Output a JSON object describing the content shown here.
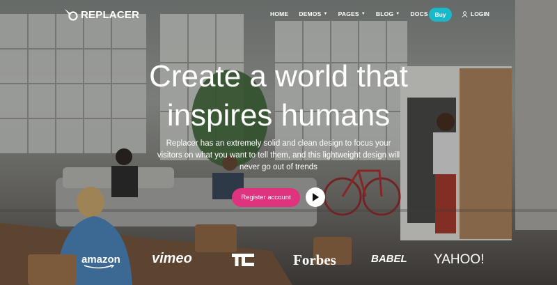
{
  "brand": {
    "name": "REPLACER"
  },
  "nav": {
    "items": [
      {
        "label": "HOME",
        "dropdown": false
      },
      {
        "label": "DEMOS",
        "dropdown": true
      },
      {
        "label": "PAGES",
        "dropdown": true
      },
      {
        "label": "BLOG",
        "dropdown": true
      },
      {
        "label": "DOCS",
        "dropdown": true
      }
    ],
    "buy_label": "Buy",
    "login_label": "LOGIN"
  },
  "hero": {
    "title_line1": "Create a world that",
    "title_line2": "inspires humans",
    "subtitle": "Replacer has an extremely solid and clean design to focus your visitors on what you want to tell them, and this lightweight design will never go out of trends",
    "register_label": "Register account"
  },
  "logos": {
    "amazon": "amazon",
    "vimeo": "vimeo",
    "tc": "TC",
    "forbes": "Forbes",
    "babel": "BABEL",
    "yahoo": "YAHOO!"
  },
  "colors": {
    "buy_button": "#1bb8c9",
    "register_button": "#e0337f"
  }
}
